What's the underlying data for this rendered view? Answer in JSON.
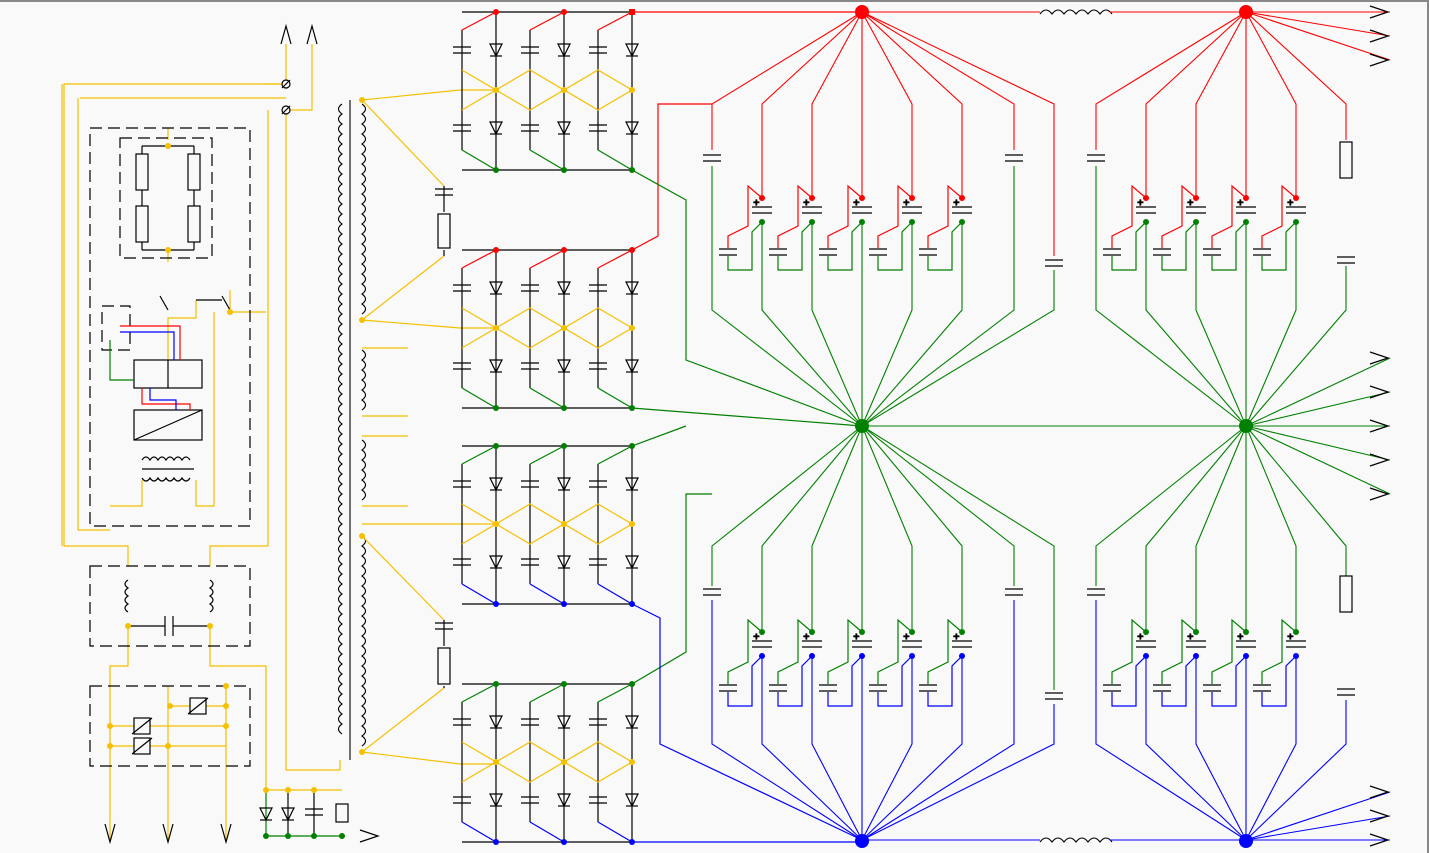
{
  "colors": {
    "background": "#f9f9f9",
    "positive_rail": "#ff0000",
    "ground_rail": "#008000",
    "negative_rail": "#0000ff",
    "ac_bus": "#f5c000",
    "component": "#000000"
  },
  "topology": {
    "rectifier_bridges": 4,
    "positive_side_capacitor_banks": 2,
    "negative_side_capacitor_banks": 2,
    "output_terminals_positive": 3,
    "output_terminals_ground": 5,
    "output_terminals_negative": 3,
    "input_terminals_top": 2,
    "input_terminals_bottom": 3
  }
}
